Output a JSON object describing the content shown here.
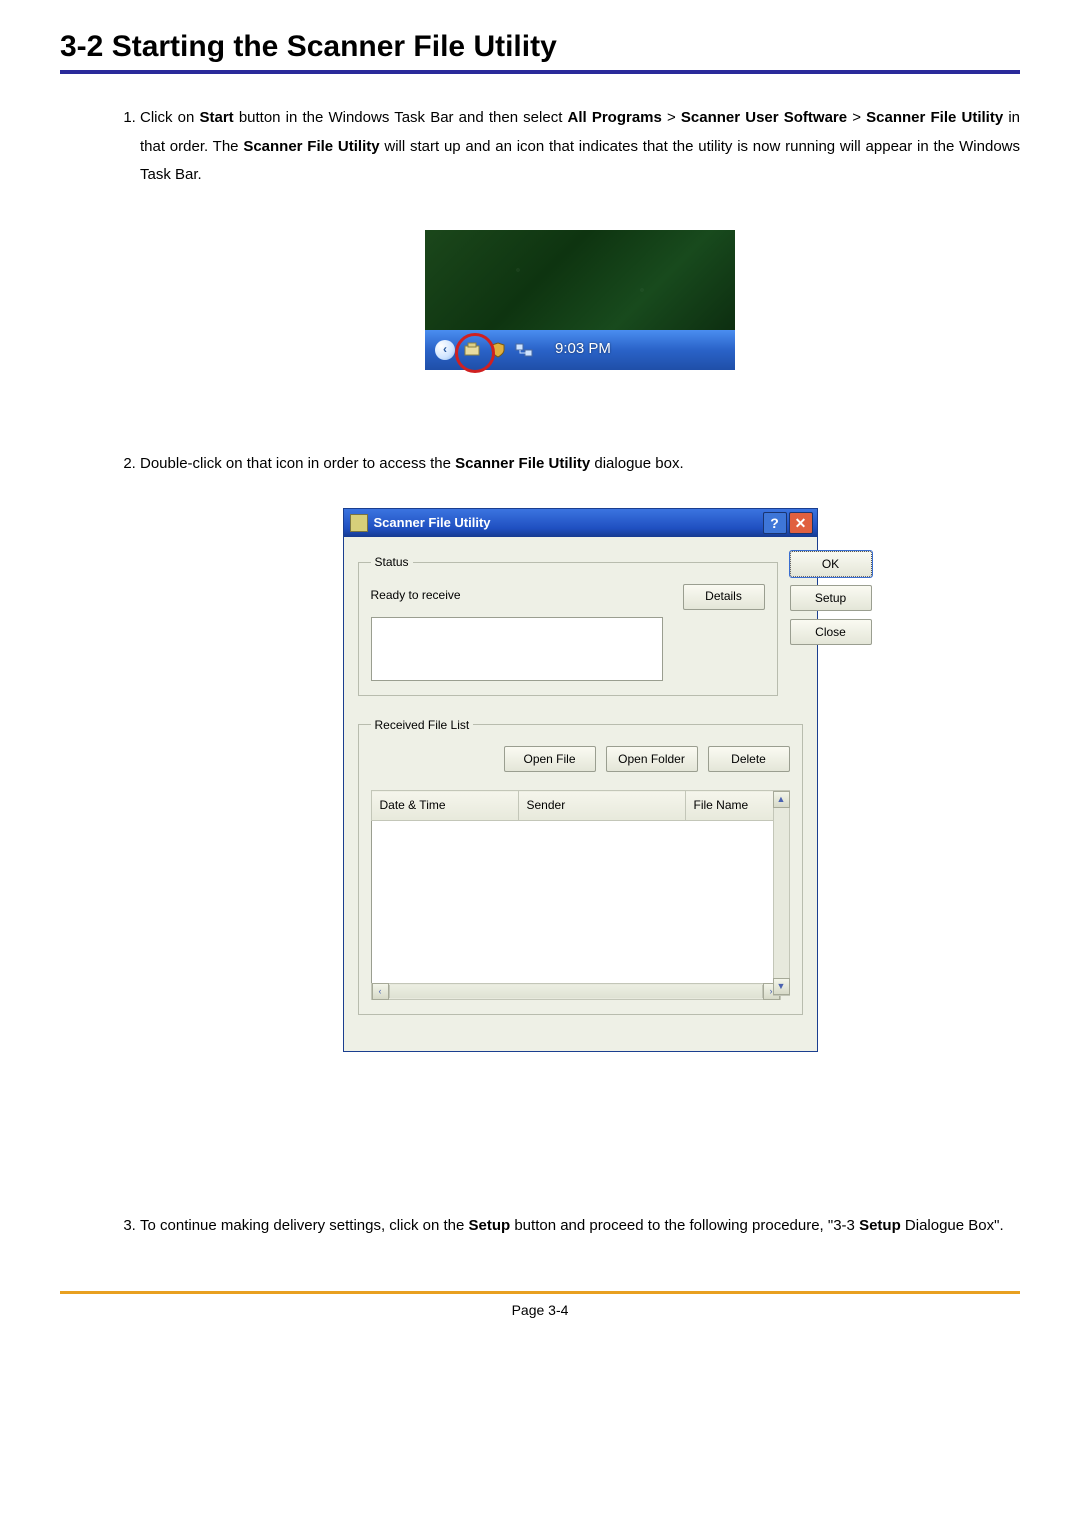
{
  "section_title": "3-2  Starting the Scanner File Utility",
  "step1": {
    "pre": "Click on ",
    "b1": "Start",
    "mid1": " button in the Windows Task Bar and then select ",
    "b2": "All Programs",
    "gt1": " > ",
    "b3": "Scanner User Software",
    "gt2": " > ",
    "b4": "Scanner File Utility",
    "mid2": " in that order. The ",
    "b5": "Scanner File Utility",
    "post": " will start up and an icon that indicates that the utility is now running will appear in the Windows Task Bar."
  },
  "step2": {
    "pre": "Double-click on that icon in order to access the ",
    "b1": "Scanner File Utility",
    "post": " dialogue box."
  },
  "step3": {
    "pre": "To continue making delivery settings, click on the ",
    "b1": "Setup",
    "mid": " button and proceed to the following procedure, \"3-3 ",
    "b2": "Setup",
    "post": " Dialogue Box\"."
  },
  "taskbar": {
    "clock": "9:03 PM"
  },
  "dialog": {
    "title": "Scanner File Utility",
    "status_group": "Status",
    "status_text": "Ready to receive",
    "details": "Details",
    "ok": "OK",
    "setup": "Setup",
    "close": "Close",
    "recv_group": "Received File List",
    "open_file": "Open File",
    "open_folder": "Open Folder",
    "delete": "Delete",
    "cols": {
      "dt": "Date & Time",
      "sender": "Sender",
      "fname": "File Name"
    }
  },
  "footer": "Page 3-4"
}
